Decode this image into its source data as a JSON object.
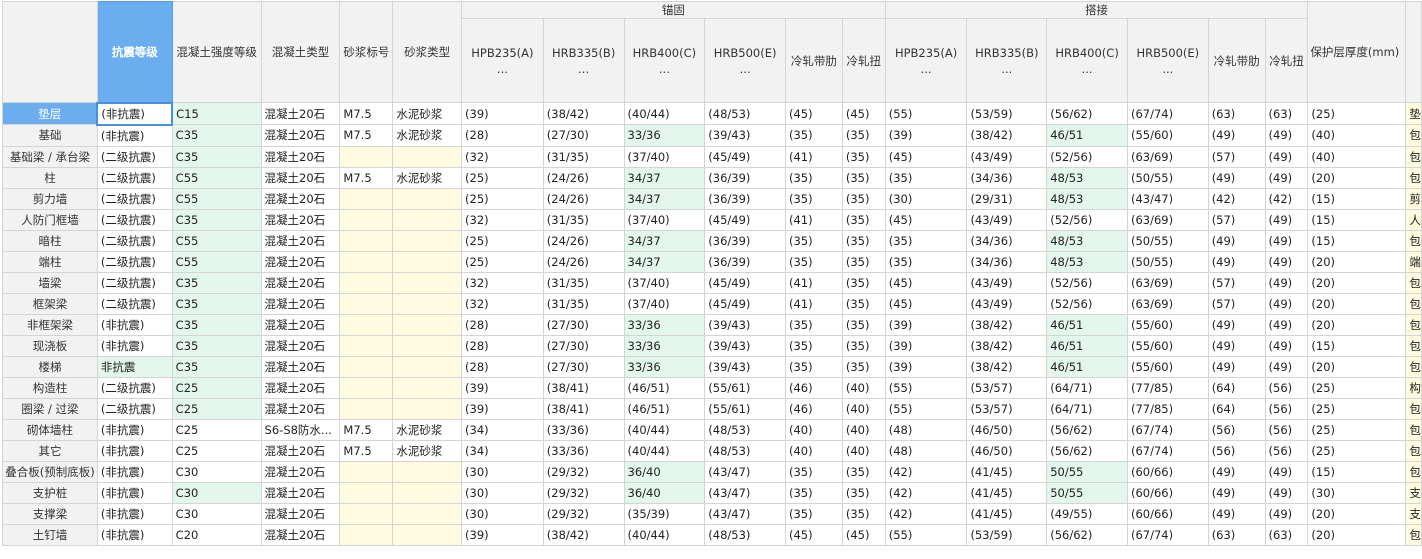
{
  "header": {
    "grade_col": "抗震等级",
    "strength_col": "混凝土强度等级",
    "concrete_type_col": "混凝土类型",
    "mortar_grade_col": "砂浆标号",
    "mortar_type_col": "砂浆类型",
    "anchor_group": "锚固",
    "lap_group": "搭接",
    "cover_col": "保护层厚度(mm)",
    "bar_cols": [
      "HPB235(A)",
      "HRB335(B)",
      "HRB400(C)",
      "HRB500(E)",
      "冷轧带肋",
      "冷轧扭"
    ],
    "ellipsis": "..."
  },
  "rows": [
    {
      "name": "垫层",
      "grade": "(非抗震)",
      "strength": "C15",
      "ctype": "混凝土20石",
      "mgrade": "M7.5",
      "mtype": "水泥砂浆",
      "a": [
        "(39)",
        "(38/42)",
        "(40/44)",
        "(48/53)",
        "(45)",
        "(45)"
      ],
      "l": [
        "(55)",
        "(53/59)",
        "(56/62)",
        "(67/74)",
        "(63)",
        "(63)"
      ],
      "cover": "(25)",
      "last": "垫"
    },
    {
      "name": "基础",
      "grade": "(非抗震)",
      "strength": "C35",
      "ctype": "混凝土20石",
      "mgrade": "M7.5",
      "mtype": "水泥砂浆",
      "a": [
        "(28)",
        "(27/30)",
        "33/36",
        "(39/43)",
        "(35)",
        "(35)"
      ],
      "l": [
        "(39)",
        "(38/42)",
        "46/51",
        "(55/60)",
        "(49)",
        "(49)"
      ],
      "cover": "(40)",
      "last": "包"
    },
    {
      "name": "基础梁 / 承台梁",
      "grade": "(二级抗震)",
      "strength": "C35",
      "ctype": "混凝土20石",
      "mgrade": "",
      "mtype": "",
      "a": [
        "(32)",
        "(31/35)",
        "(37/40)",
        "(45/49)",
        "(41)",
        "(35)"
      ],
      "l": [
        "(45)",
        "(43/49)",
        "(52/56)",
        "(63/69)",
        "(57)",
        "(49)"
      ],
      "cover": "(40)",
      "last": "包"
    },
    {
      "name": "柱",
      "grade": "(二级抗震)",
      "strength": "C55",
      "ctype": "混凝土20石",
      "mgrade": "M7.5",
      "mtype": "水泥砂浆",
      "a": [
        "(25)",
        "(24/26)",
        "34/37",
        "(36/39)",
        "(35)",
        "(35)"
      ],
      "l": [
        "(35)",
        "(34/36)",
        "48/53",
        "(50/55)",
        "(49)",
        "(49)"
      ],
      "cover": "(20)",
      "last": "包"
    },
    {
      "name": "剪力墙",
      "grade": "(二级抗震)",
      "strength": "C55",
      "ctype": "混凝土20石",
      "mgrade": "",
      "mtype": "",
      "a": [
        "(25)",
        "(24/26)",
        "34/37",
        "(36/39)",
        "(35)",
        "(35)"
      ],
      "l": [
        "(30)",
        "(29/31)",
        "48/53",
        "(43/47)",
        "(42)",
        "(42)"
      ],
      "cover": "(15)",
      "last": "剪"
    },
    {
      "name": "人防门框墙",
      "grade": "(二级抗震)",
      "strength": "C35",
      "ctype": "混凝土20石",
      "mgrade": "",
      "mtype": "",
      "a": [
        "(32)",
        "(31/35)",
        "(37/40)",
        "(45/49)",
        "(41)",
        "(35)"
      ],
      "l": [
        "(45)",
        "(43/49)",
        "(52/56)",
        "(63/69)",
        "(57)",
        "(49)"
      ],
      "cover": "(15)",
      "last": "人"
    },
    {
      "name": "暗柱",
      "grade": "(二级抗震)",
      "strength": "C55",
      "ctype": "混凝土20石",
      "mgrade": "",
      "mtype": "",
      "a": [
        "(25)",
        "(24/26)",
        "34/37",
        "(36/39)",
        "(35)",
        "(35)"
      ],
      "l": [
        "(35)",
        "(34/36)",
        "48/53",
        "(50/55)",
        "(49)",
        "(49)"
      ],
      "cover": "(15)",
      "last": "包"
    },
    {
      "name": "端柱",
      "grade": "(二级抗震)",
      "strength": "C55",
      "ctype": "混凝土20石",
      "mgrade": "",
      "mtype": "",
      "a": [
        "(25)",
        "(24/26)",
        "34/37",
        "(36/39)",
        "(35)",
        "(35)"
      ],
      "l": [
        "(35)",
        "(34/36)",
        "48/53",
        "(50/55)",
        "(49)",
        "(49)"
      ],
      "cover": "(20)",
      "last": "端"
    },
    {
      "name": "墙梁",
      "grade": "(二级抗震)",
      "strength": "C35",
      "ctype": "混凝土20石",
      "mgrade": "",
      "mtype": "",
      "a": [
        "(32)",
        "(31/35)",
        "(37/40)",
        "(45/49)",
        "(41)",
        "(35)"
      ],
      "l": [
        "(45)",
        "(43/49)",
        "(52/56)",
        "(63/69)",
        "(57)",
        "(49)"
      ],
      "cover": "(20)",
      "last": "包"
    },
    {
      "name": "框架梁",
      "grade": "(二级抗震)",
      "strength": "C35",
      "ctype": "混凝土20石",
      "mgrade": "",
      "mtype": "",
      "a": [
        "(32)",
        "(31/35)",
        "(37/40)",
        "(45/49)",
        "(41)",
        "(35)"
      ],
      "l": [
        "(45)",
        "(43/49)",
        "(52/56)",
        "(63/69)",
        "(57)",
        "(49)"
      ],
      "cover": "(20)",
      "last": "包"
    },
    {
      "name": "非框架梁",
      "grade": "(非抗震)",
      "strength": "C35",
      "ctype": "混凝土20石",
      "mgrade": "",
      "mtype": "",
      "a": [
        "(28)",
        "(27/30)",
        "33/36",
        "(39/43)",
        "(35)",
        "(35)"
      ],
      "l": [
        "(39)",
        "(38/42)",
        "46/51",
        "(55/60)",
        "(49)",
        "(49)"
      ],
      "cover": "(20)",
      "last": "包"
    },
    {
      "name": "现浇板",
      "grade": "(非抗震)",
      "strength": "C35",
      "ctype": "混凝土20石",
      "mgrade": "",
      "mtype": "",
      "a": [
        "(28)",
        "(27/30)",
        "33/36",
        "(39/43)",
        "(35)",
        "(35)"
      ],
      "l": [
        "(39)",
        "(38/42)",
        "46/51",
        "(55/60)",
        "(49)",
        "(49)"
      ],
      "cover": "(15)",
      "last": "包"
    },
    {
      "name": "楼梯",
      "grade": "非抗震",
      "strength": "C35",
      "ctype": "混凝土20石",
      "mgrade": "",
      "mtype": "",
      "a": [
        "(28)",
        "(27/30)",
        "33/36",
        "(39/43)",
        "(35)",
        "(35)"
      ],
      "l": [
        "(39)",
        "(38/42)",
        "46/51",
        "(55/60)",
        "(49)",
        "(49)"
      ],
      "cover": "(20)",
      "last": "包"
    },
    {
      "name": "构造柱",
      "grade": "(二级抗震)",
      "strength": "C25",
      "ctype": "混凝土20石",
      "mgrade": "",
      "mtype": "",
      "a": [
        "(39)",
        "(38/41)",
        "(46/51)",
        "(55/61)",
        "(46)",
        "(40)"
      ],
      "l": [
        "(55)",
        "(53/57)",
        "(64/71)",
        "(77/85)",
        "(64)",
        "(56)"
      ],
      "cover": "(25)",
      "last": "构"
    },
    {
      "name": "圈梁 / 过梁",
      "grade": "(二级抗震)",
      "strength": "C25",
      "ctype": "混凝土20石",
      "mgrade": "",
      "mtype": "",
      "a": [
        "(39)",
        "(38/41)",
        "(46/51)",
        "(55/61)",
        "(46)",
        "(40)"
      ],
      "l": [
        "(55)",
        "(53/57)",
        "(64/71)",
        "(77/85)",
        "(64)",
        "(56)"
      ],
      "cover": "(25)",
      "last": "包"
    },
    {
      "name": "砌体墙柱",
      "grade": "(非抗震)",
      "strength": "C25",
      "ctype": "S6-S8防水...",
      "mgrade": "M7.5",
      "mtype": "水泥砂浆",
      "a": [
        "(34)",
        "(33/36)",
        "(40/44)",
        "(48/53)",
        "(40)",
        "(40)"
      ],
      "l": [
        "(48)",
        "(46/50)",
        "(56/62)",
        "(67/74)",
        "(56)",
        "(56)"
      ],
      "cover": "(25)",
      "last": "包"
    },
    {
      "name": "其它",
      "grade": "(非抗震)",
      "strength": "C25",
      "ctype": "混凝土20石",
      "mgrade": "M7.5",
      "mtype": "水泥砂浆",
      "a": [
        "(34)",
        "(33/36)",
        "(40/44)",
        "(48/53)",
        "(40)",
        "(40)"
      ],
      "l": [
        "(48)",
        "(46/50)",
        "(56/62)",
        "(67/74)",
        "(56)",
        "(56)"
      ],
      "cover": "(25)",
      "last": "包"
    },
    {
      "name": "叠合板(预制底板)",
      "grade": "(非抗震)",
      "strength": "C30",
      "ctype": "混凝土20石",
      "mgrade": "",
      "mtype": "",
      "a": [
        "(30)",
        "(29/32)",
        "36/40",
        "(43/47)",
        "(35)",
        "(35)"
      ],
      "l": [
        "(42)",
        "(41/45)",
        "50/55",
        "(60/66)",
        "(49)",
        "(49)"
      ],
      "cover": "(15)",
      "last": "包"
    },
    {
      "name": "支护桩",
      "grade": "(非抗震)",
      "strength": "C30",
      "ctype": "混凝土20石",
      "mgrade": "",
      "mtype": "",
      "a": [
        "(30)",
        "(29/32)",
        "36/40",
        "(43/47)",
        "(35)",
        "(35)"
      ],
      "l": [
        "(42)",
        "(41/45)",
        "50/55",
        "(60/66)",
        "(49)",
        "(49)"
      ],
      "cover": "(30)",
      "last": "支"
    },
    {
      "name": "支撑梁",
      "grade": "(非抗震)",
      "strength": "C30",
      "ctype": "混凝土20石",
      "mgrade": "",
      "mtype": "",
      "a": [
        "(30)",
        "(29/32)",
        "(35/39)",
        "(43/47)",
        "(35)",
        "(35)"
      ],
      "l": [
        "(42)",
        "(41/45)",
        "(49/55)",
        "(60/66)",
        "(49)",
        "(49)"
      ],
      "cover": "(20)",
      "last": "支"
    },
    {
      "name": "土钉墙",
      "grade": "(非抗震)",
      "strength": "C20",
      "ctype": "混凝土20石",
      "mgrade": "",
      "mtype": "",
      "a": [
        "(39)",
        "(38/42)",
        "(40/44)",
        "(48/53)",
        "(45)",
        "(45)"
      ],
      "l": [
        "(55)",
        "(53/59)",
        "(56/62)",
        "(67/74)",
        "(63)",
        "(63)"
      ],
      "cover": "(20)",
      "last": "包"
    }
  ],
  "colors": {
    "selected_header": "#6aaef0",
    "modified_cell": "#e3f6ec",
    "mortar_empty": "#fffbe0",
    "header_bg": "#f2f2f2"
  }
}
